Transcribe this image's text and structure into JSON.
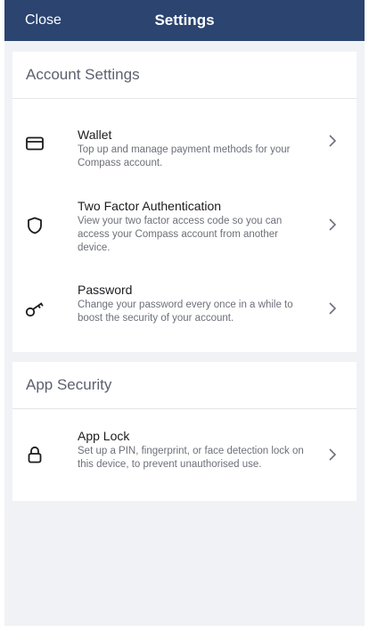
{
  "header": {
    "close_label": "Close",
    "title": "Settings"
  },
  "account_section": {
    "title": "Account Settings",
    "items": [
      {
        "title": "Wallet",
        "description": "Top up and manage payment methods for your Compass account.",
        "icon": "wallet-icon"
      },
      {
        "title": "Two Factor Authentication",
        "description": "View your two factor access code so you can access your Compass account from another device.",
        "icon": "shield-icon"
      },
      {
        "title": "Password",
        "description": "Change your password every once in a while to boost the security of your account.",
        "icon": "key-icon"
      }
    ]
  },
  "app_section": {
    "title": "App Security",
    "items": [
      {
        "title": "App Lock",
        "description": "Set up a PIN, fingerprint, or face detection lock on this device, to prevent unauthorised use.",
        "icon": "lock-icon"
      }
    ]
  },
  "colors": {
    "nav_background": "#2b4470",
    "page_background": "#f1f2f6",
    "card_background": "#ffffff"
  }
}
